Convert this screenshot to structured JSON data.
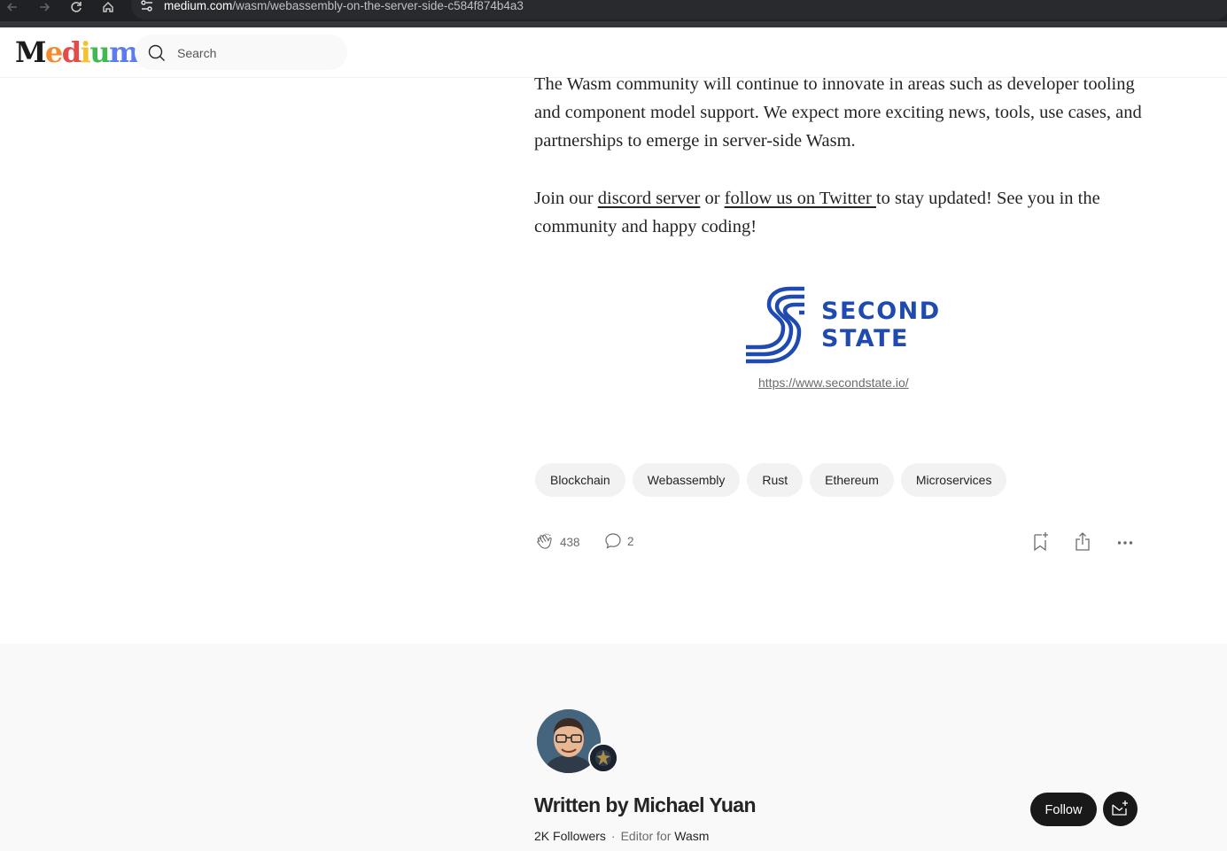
{
  "browser": {
    "url_host": "medium.com",
    "url_path": "/wasm/webassembly-on-the-server-side-c584f874b4a3"
  },
  "header": {
    "logo": "Medium",
    "logo_letters": [
      {
        "ch": "M",
        "color": "#1b1b1b"
      },
      {
        "ch": "e",
        "color": "#f28b30"
      },
      {
        "ch": "d",
        "color": "#e54b4b"
      },
      {
        "ch": "i",
        "color": "#f2c230"
      },
      {
        "ch": "u",
        "color": "#3fb950"
      },
      {
        "ch": "m",
        "color": "#5b7cf0"
      }
    ],
    "search_placeholder": "Search"
  },
  "article": {
    "paragraph1": "The Wasm community will continue to innovate in areas such as developer tooling and component model support. We expect more exciting news, tools, use cases, and partnerships to emerge in server-side Wasm.",
    "p2_before": "Join our ",
    "p2_link1": "discord server",
    "p2_between": " or ",
    "p2_link2": "follow us on Twitter ",
    "p2_after": "to stay updated! See you in the community and happy coding!",
    "figure_brand_line1": "SECOND",
    "figure_brand_line2": "STATE",
    "figure_caption": "https://www.secondstate.io/"
  },
  "tags": [
    "Blockchain",
    "Webassembly",
    "Rust",
    "Ethereum",
    "Microservices"
  ],
  "actions": {
    "claps": "438",
    "responses": "2"
  },
  "author": {
    "written_by": "Written by Michael Yuan",
    "followers": "2K Followers",
    "editor_prefix": "Editor for ",
    "publication": "Wasm",
    "follow_label": "Follow"
  },
  "colors": {
    "brand_blue": "#1f4bb0",
    "dark_button": "#191919",
    "tag_bg": "#f2f2f2"
  }
}
